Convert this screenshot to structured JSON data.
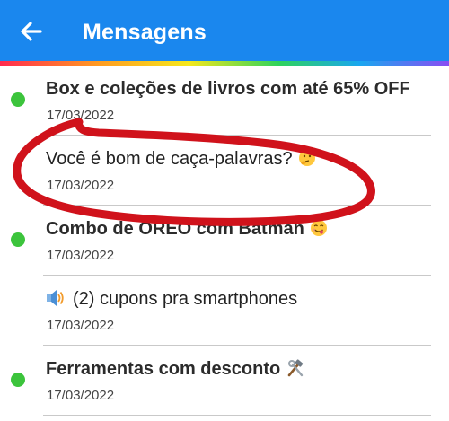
{
  "header": {
    "title": "Mensagens",
    "back_icon": "arrow-left-icon",
    "background_color": "#1a87ee"
  },
  "messages": [
    {
      "title": "Box e coleções de livros com até 65% OFF",
      "date": "17/03/2022",
      "unread": true,
      "emoji": ""
    },
    {
      "title": "Você é bom de caça-palavras?",
      "date": "17/03/2022",
      "unread": false,
      "emoji": "thinking-face-icon"
    },
    {
      "title": "Combo de OREO com Batman",
      "date": "17/03/2022",
      "unread": true,
      "emoji": "face-savoring-food-icon"
    },
    {
      "title": "(2) cupons pra smartphones",
      "date": "17/03/2022",
      "unread": false,
      "emoji": "speaker-icon"
    },
    {
      "title": "Ferramentas com desconto",
      "date": "17/03/2022",
      "unread": true,
      "emoji": "hammer-and-wrench-icon"
    }
  ],
  "colors": {
    "unread_dot": "#3cc43c",
    "annotation_stroke": "#d0121b"
  }
}
